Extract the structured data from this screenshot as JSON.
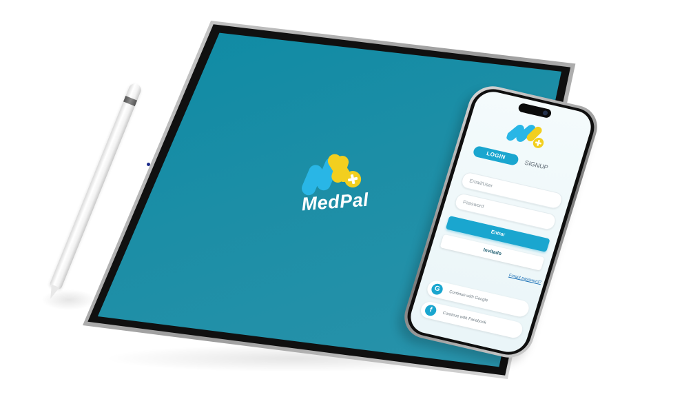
{
  "splash": {
    "app_name": "MedPal",
    "logo_icon": "medpal-logo-icon"
  },
  "login_screen": {
    "tabs": {
      "login_label": "LOGIN",
      "signup_label": "SIGNUP"
    },
    "email_field": {
      "placeholder": "Email/User",
      "value": ""
    },
    "password_field": {
      "placeholder": "Password",
      "value": ""
    },
    "primary_button_label": "Entrar",
    "secondary_button_label": "Invitado",
    "forgot_password_link": "Forgot password?",
    "social": [
      {
        "label": "Continue with Google",
        "icon": "google-icon",
        "glyph": "G"
      },
      {
        "label": "Continue with Facebook",
        "icon": "facebook-icon",
        "glyph": "f"
      }
    ]
  },
  "colors": {
    "tablet_screen": "#1a8ea6",
    "accent_blue": "#1aa6cf",
    "logo_blue": "#29b6e6",
    "logo_yellow": "#f2cf1f"
  }
}
